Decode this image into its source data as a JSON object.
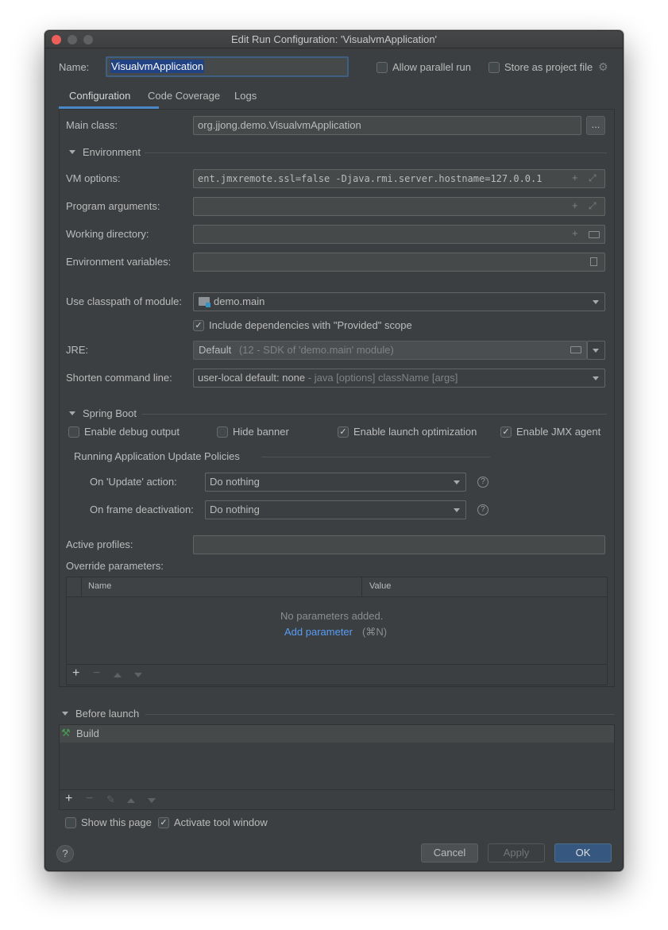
{
  "window": {
    "title": "Edit Run Configuration: 'VisualvmApplication'"
  },
  "header": {
    "name_label": "Name:",
    "name_value": "VisualvmApplication",
    "allow_parallel": "Allow parallel run",
    "store_as_project": "Store as project file"
  },
  "tabs": [
    "Configuration",
    "Code Coverage",
    "Logs"
  ],
  "config": {
    "main_class_label": "Main class:",
    "main_class_value": "org.jjong.demo.VisualvmApplication",
    "browse_label": "...",
    "environment_section": "Environment",
    "vm_options_label": "VM options:",
    "vm_options_value": "ent.jmxremote.ssl=false -Djava.rmi.server.hostname=127.0.0.1",
    "program_args_label": "Program arguments:",
    "working_dir_label": "Working directory:",
    "env_vars_label": "Environment variables:",
    "classpath_label": "Use classpath of module:",
    "classpath_value": "demo.main",
    "include_deps_label": "Include dependencies with \"Provided\" scope",
    "jre_label": "JRE:",
    "jre_value": "Default",
    "jre_hint": "(12 - SDK of 'demo.main' module)",
    "shorten_label": "Shorten command line:",
    "shorten_value": "user-local default: none",
    "shorten_hint": "- java [options] className [args]"
  },
  "spring": {
    "section": "Spring Boot",
    "debug_output": "Enable debug output",
    "hide_banner": "Hide banner",
    "launch_opt": "Enable launch optimization",
    "jmx_agent": "Enable JMX agent",
    "policies_title": "Running Application Update Policies",
    "on_update_label": "On 'Update' action:",
    "on_update_value": "Do nothing",
    "on_frame_label": "On frame deactivation:",
    "on_frame_value": "Do nothing",
    "active_profiles_label": "Active profiles:",
    "override_label": "Override parameters:",
    "table_headers": [
      "Name",
      "Value"
    ],
    "empty_text": "No parameters added.",
    "add_param": "Add parameter",
    "add_param_shortcut": "(⌘N)"
  },
  "before_launch": {
    "section": "Before launch",
    "items": [
      "Build"
    ]
  },
  "footer": {
    "show_page": "Show this page",
    "activate_tool": "Activate tool window",
    "help": "?",
    "cancel": "Cancel",
    "apply": "Apply",
    "ok": "OK"
  },
  "colors": {
    "background": "#3c3f41",
    "input_bg": "#45494a",
    "accent": "#365880",
    "link": "#589df6",
    "selection": "#214283"
  }
}
